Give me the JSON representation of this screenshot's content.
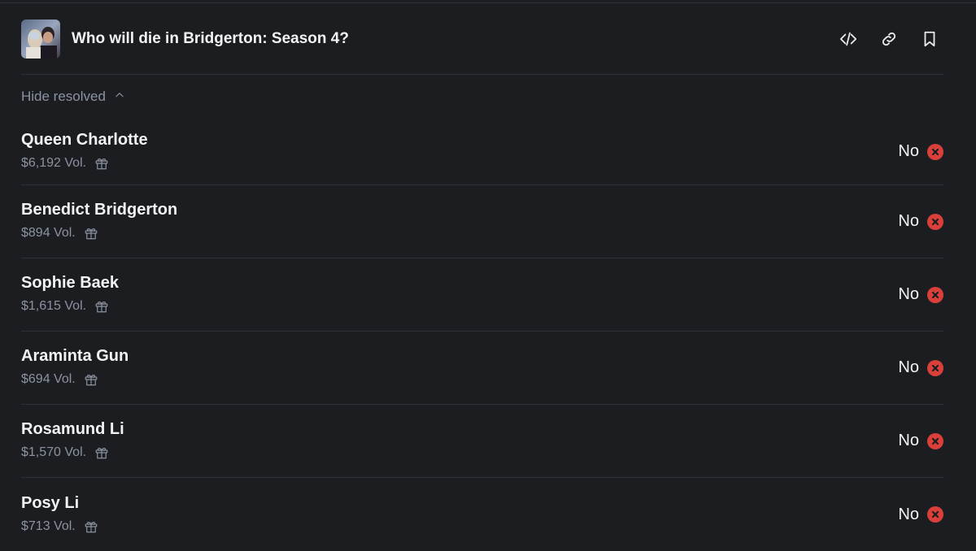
{
  "header": {
    "title": "Who will die in Bridgerton: Season 4?",
    "thumbnail_icon": "market-thumbnail",
    "actions": [
      {
        "name": "embed-code-icon"
      },
      {
        "name": "link-icon"
      },
      {
        "name": "bookmark-icon"
      }
    ]
  },
  "filter": {
    "label": "Hide resolved"
  },
  "outcomes": [
    {
      "name": "Queen Charlotte",
      "volume": "$6,192 Vol.",
      "result": "No"
    },
    {
      "name": "Benedict Bridgerton",
      "volume": "$894 Vol.",
      "result": "No"
    },
    {
      "name": "Sophie Baek",
      "volume": "$1,615 Vol.",
      "result": "No"
    },
    {
      "name": "Araminta Gun",
      "volume": "$694 Vol.",
      "result": "No"
    },
    {
      "name": "Rosamund Li",
      "volume": "$1,570 Vol.",
      "result": "No"
    },
    {
      "name": "Posy Li",
      "volume": "$713 Vol.",
      "result": "No"
    }
  ],
  "colors": {
    "background": "#1b1d21",
    "divider": "#2c2f35",
    "muted_text": "#8b93a1",
    "resolved_no": "#d9403a"
  }
}
